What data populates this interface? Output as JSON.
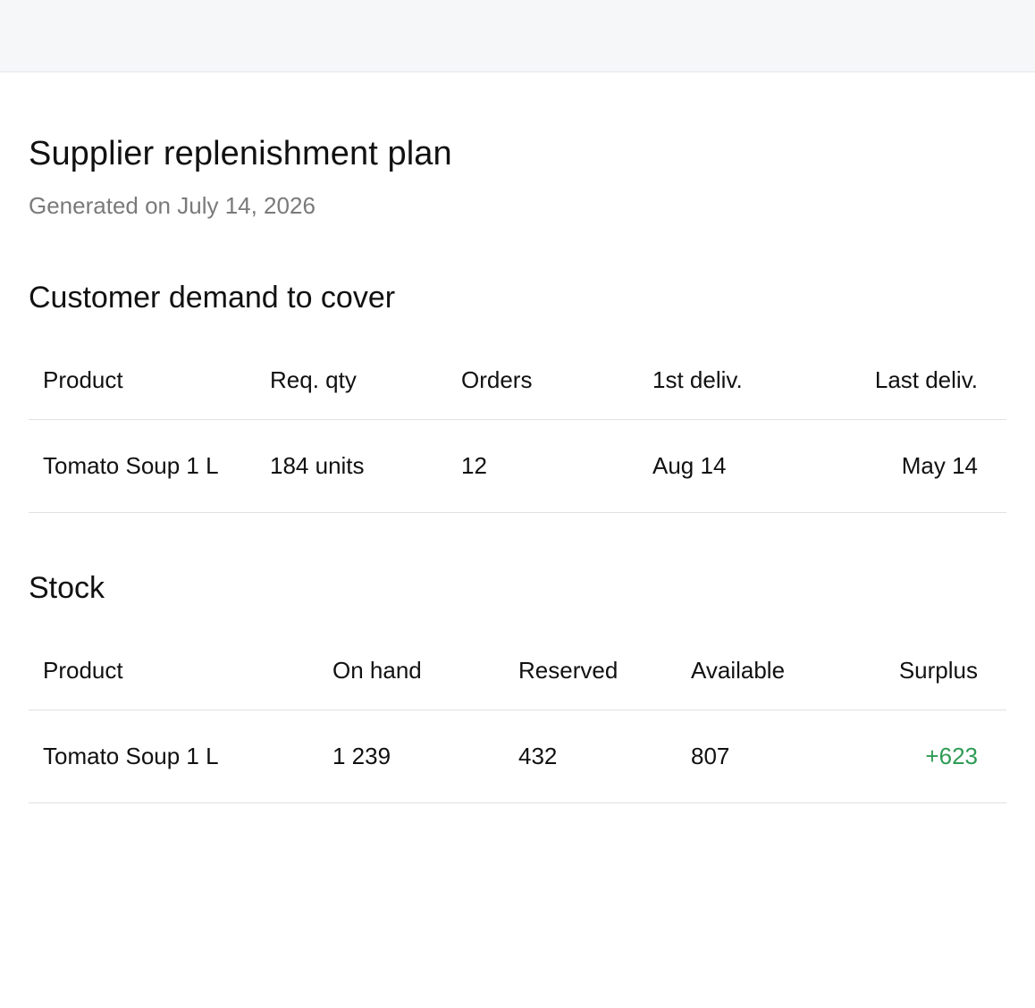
{
  "page": {
    "title": "Supplier replenishment plan",
    "subtitle": "Generated on July 14, 2026"
  },
  "demand": {
    "title": "Customer demand to cover",
    "headers": {
      "product": "Product",
      "req_qty": "Req. qty",
      "orders": "Orders",
      "first_delivery": "1st deliv.",
      "last_delivery": "Last deliv."
    },
    "rows": [
      {
        "product": "Tomato Soup 1 L",
        "req_qty": "184 units",
        "orders": "12",
        "first_delivery": "Aug 14",
        "last_delivery": "May 14"
      }
    ]
  },
  "stock": {
    "title": "Stock",
    "headers": {
      "product": "Product",
      "on_hand": "On hand",
      "reserved": "Reserved",
      "available": "Available",
      "surplus": "Surplus"
    },
    "rows": [
      {
        "product": "Tomato Soup 1 L",
        "on_hand": "1 239",
        "reserved": "432",
        "available": "807",
        "surplus": "+623"
      }
    ]
  },
  "colors": {
    "surplus_positive": "#2e9b54",
    "subtitle_gray": "#7a7a7a",
    "topbar_bg": "#f6f7f9"
  }
}
